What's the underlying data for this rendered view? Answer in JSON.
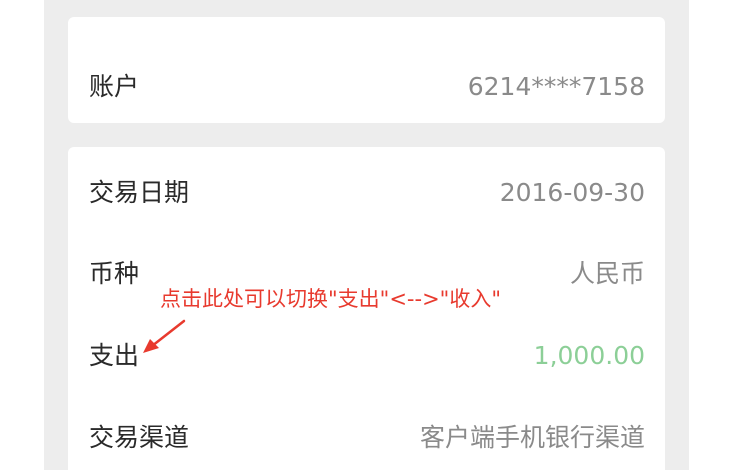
{
  "account_card": {
    "label": "账户",
    "value": "6214****7158"
  },
  "detail_card": {
    "rows": [
      {
        "label": "交易日期",
        "value": "2016-09-30"
      },
      {
        "label": "币种",
        "value": "人民币"
      },
      {
        "label": "支出",
        "value": "1,000.00"
      },
      {
        "label": "交易渠道",
        "value": "客户端手机银行渠道"
      }
    ]
  },
  "annotation": {
    "text": "点击此处可以切换\"支出\"<-->\"收入\"",
    "color": "#e83a2e"
  },
  "colors": {
    "background": "#ededed",
    "card": "#ffffff",
    "label": "#2a2a2a",
    "value": "#8a8a8a",
    "amount": "#8ccf97"
  }
}
